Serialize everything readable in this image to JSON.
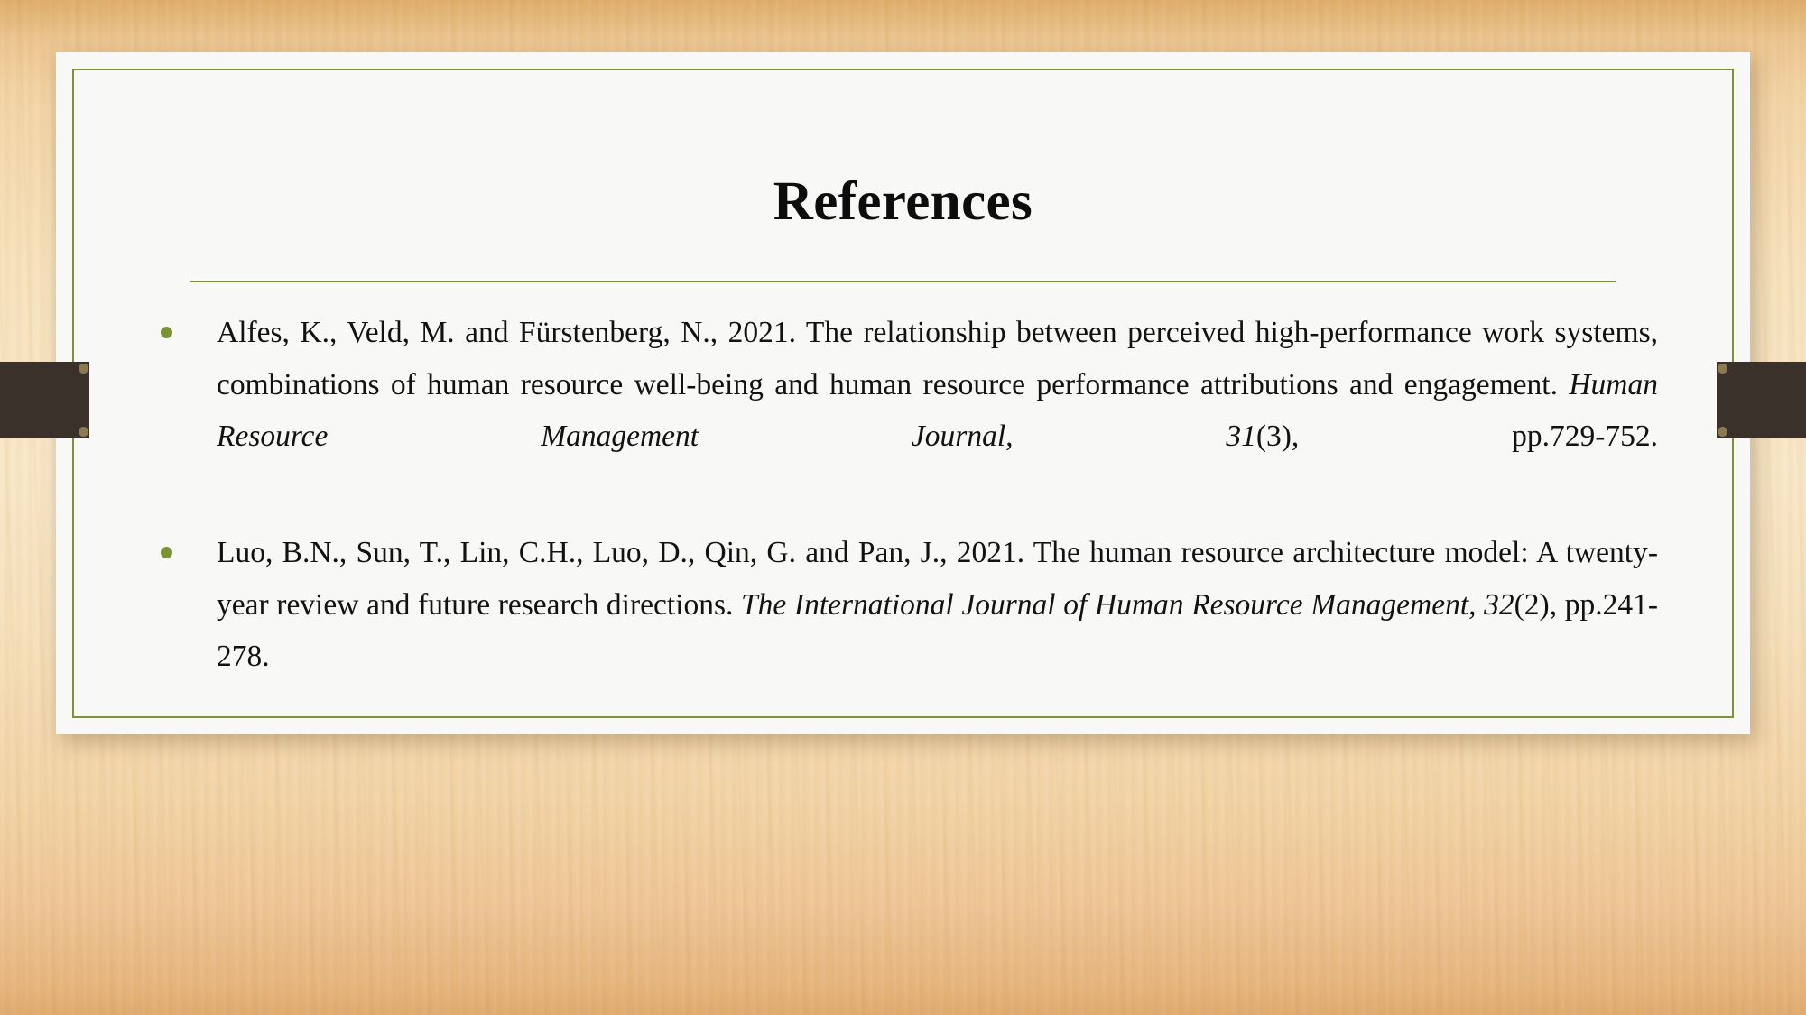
{
  "slide": {
    "title": "References",
    "background_color": "#f3d6a8",
    "accent_color": "#7b9338",
    "card_color": "#f8f8f7",
    "tab_color": "#3a322a",
    "bullet_icon": "bullet-dot-icon"
  },
  "references": [
    {
      "id": "reference-1",
      "bullet": "•",
      "segments": [
        {
          "text": "Alfes, K., Veld, M. and Fürstenberg, N., 2021. The relationship between perceived high-performance work systems, combinations of human resource well-being and human resource performance attributions and engagement. ",
          "style": "normal"
        },
        {
          "text": "Human Resource Management Journal",
          "style": "italic"
        },
        {
          "text": ", ",
          "style": "italic"
        },
        {
          "text": "31",
          "style": "italic"
        },
        {
          "text": "(3), pp.729-752.",
          "style": "normal"
        }
      ],
      "plain_text": "Alfes, K., Veld, M. and Fürstenberg, N., 2021. The relationship between perceived high-performance work systems, combinations of human resource well-being and human resource performance attributions and engagement. Human Resource Management Journal, 31(3), pp.729-752.",
      "authors": "Alfes, K., Veld, M. and Fürstenberg, N.",
      "year": "2021",
      "article_title": "The relationship between perceived high-performance work systems, combinations of human resource well-being and human resource performance attributions and engagement.",
      "journal": "Human Resource Management Journal",
      "volume": "31",
      "issue": "(3)",
      "pages": "pp.729-752."
    },
    {
      "id": "reference-2",
      "bullet": "•",
      "segments": [
        {
          "text": "Luo, B.N., Sun, T., Lin, C.H., Luo, D., Qin, G. and Pan, J., 2021. The human resource architecture model: A twenty-year review and future research directions. ",
          "style": "normal"
        },
        {
          "text": "The International Journal of Human Resource Management",
          "style": "italic"
        },
        {
          "text": ", ",
          "style": "italic"
        },
        {
          "text": "32",
          "style": "italic"
        },
        {
          "text": "(2), pp.241-278.",
          "style": "normal"
        }
      ],
      "plain_text": "Luo, B.N., Sun, T., Lin, C.H., Luo, D., Qin, G. and Pan, J., 2021. The human resource architecture model: A twenty-year review and future research directions. The International Journal of Human Resource Management, 32(2), pp.241-278.",
      "authors": "Luo, B.N., Sun, T., Lin, C.H., Luo, D., Qin, G. and Pan, J.",
      "year": "2021",
      "article_title": "The human resource architecture model: A twenty-year review and future research directions.",
      "journal": "The International Journal of Human Resource Management",
      "volume": "32",
      "issue": "(2)",
      "pages": "pp.241-278."
    }
  ]
}
